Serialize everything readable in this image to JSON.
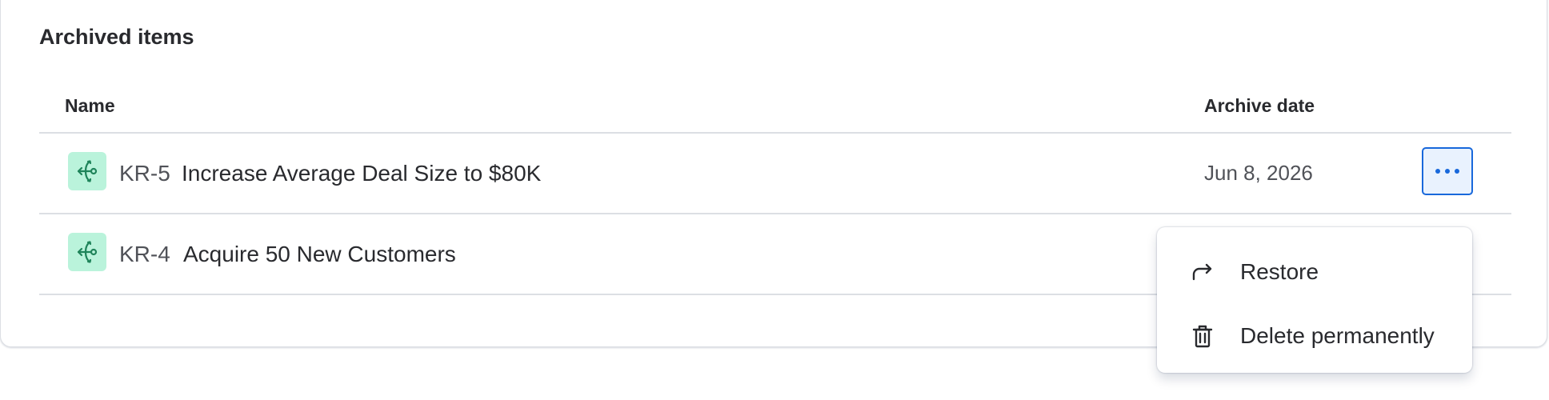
{
  "section": {
    "title": "Archived items"
  },
  "table": {
    "columns": {
      "name": "Name",
      "archive_date": "Archive date"
    },
    "rows": [
      {
        "icon": "key-result-icon",
        "key": "KR-5",
        "name": "Increase Average Deal Size to $80K",
        "archive_date": "Jun 8, 2026",
        "actions_icon": "more-horizontal-icon"
      },
      {
        "icon": "key-result-icon",
        "key": "KR-4",
        "name": "Acquire 50 New Customers"
      }
    ]
  },
  "menu": {
    "items": [
      {
        "label": "Restore",
        "icon": "restore-icon"
      },
      {
        "label": "Delete permanently",
        "icon": "trash-icon"
      }
    ]
  },
  "colors": {
    "accent": "#1868db",
    "accent_bg": "#e9f2fe",
    "icon_bg": "#baf3db",
    "icon_fg": "#1f845a",
    "border": "#dcdfe4",
    "text": "#292a2e",
    "subtle_text": "#505258"
  }
}
